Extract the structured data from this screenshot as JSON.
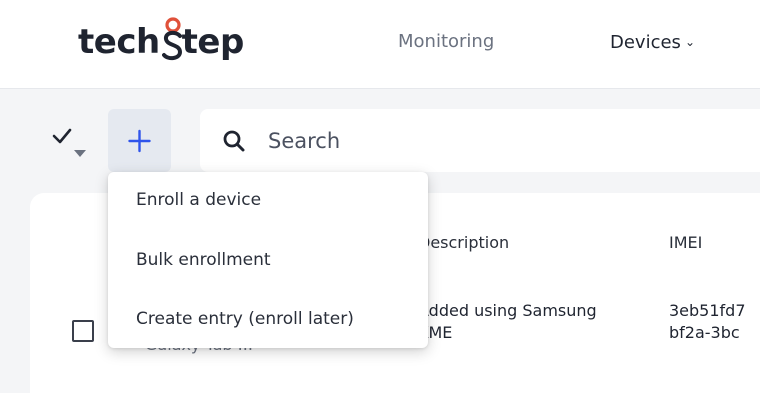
{
  "header": {
    "logo": {
      "text_before": "tech",
      "text_after": "tep"
    },
    "nav": [
      {
        "label": "Monitoring"
      },
      {
        "label": "Devices",
        "icon": "chevron-down-icon"
      }
    ]
  },
  "toolbar": {
    "select_icon": "checkmark-dropdown-icon",
    "add_icon": "plus-icon",
    "accent": "#2f54eb",
    "search": {
      "placeholder": "Search",
      "value": ""
    }
  },
  "add_menu": {
    "items": [
      {
        "label": "Enroll a device"
      },
      {
        "label": "Bulk enrollment"
      },
      {
        "label": "Create entry (enroll later)"
      }
    ]
  },
  "table": {
    "columns": [
      {
        "label": "Description"
      },
      {
        "label": "IMEI"
      }
    ],
    "rows": [
      {
        "name": "Galaxy Tab ...",
        "description": [
          "Added using Samsung",
          "KME"
        ],
        "imei": [
          "3eb51fd7",
          "bf2a-3bc"
        ]
      }
    ]
  }
}
